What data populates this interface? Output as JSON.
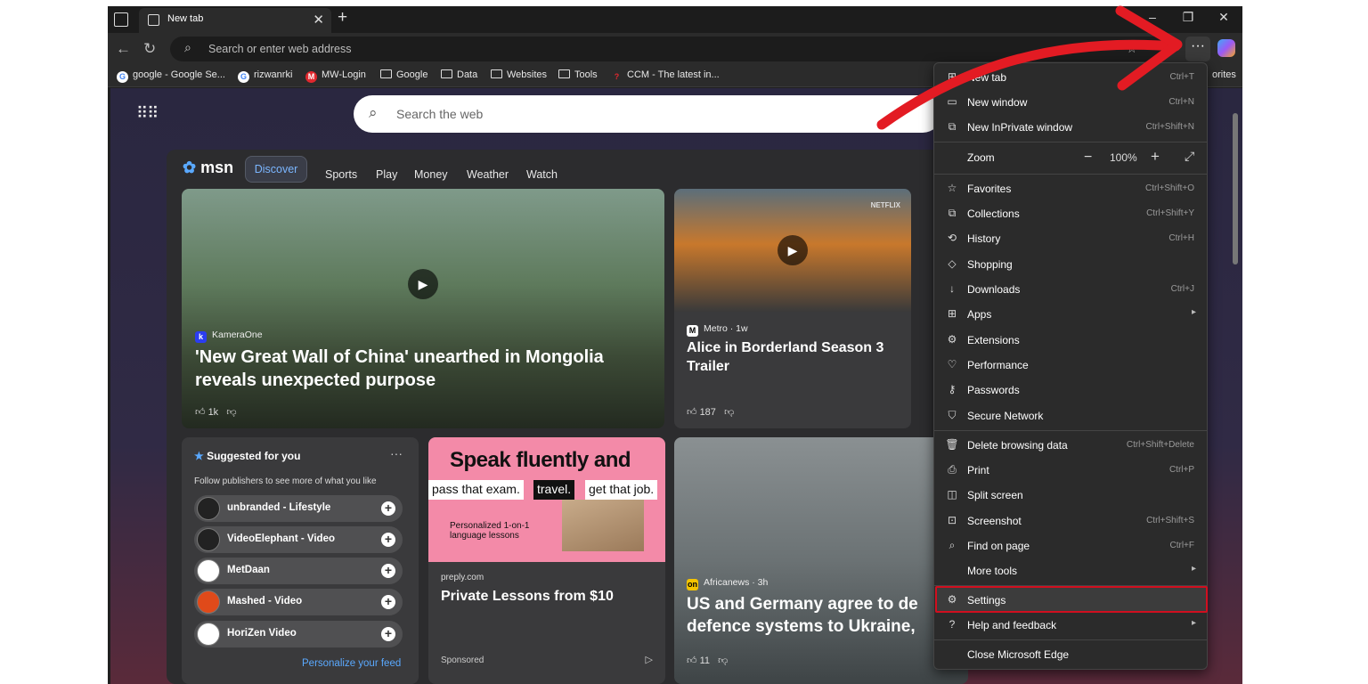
{
  "browser": {
    "tab_title": "New tab",
    "address_placeholder": "Search or enter web address",
    "bookmarks": [
      {
        "label": "google - Google Se...",
        "icon": "google-icon"
      },
      {
        "label": "rizwanrki",
        "icon": "google-icon"
      },
      {
        "label": "MW-Login",
        "icon": "mw-icon"
      },
      {
        "label": "Google",
        "icon": "folder-icon"
      },
      {
        "label": "Data",
        "icon": "folder-icon"
      },
      {
        "label": "Websites",
        "icon": "folder-icon"
      },
      {
        "label": "Tools",
        "icon": "folder-icon"
      },
      {
        "label": "CCM - The latest in...",
        "icon": "ccm-icon"
      }
    ],
    "bookmarks_overflow": "orites"
  },
  "newtab": {
    "search_placeholder": "Search the web",
    "msn_logo": "msn",
    "nav": [
      "Discover",
      "Sports",
      "Play",
      "Money",
      "Weather",
      "Watch"
    ],
    "hero": {
      "source": "KameraOne",
      "headline": "'New Great Wall of China' unearthed in Mongolia reveals unexpected purpose",
      "likes": "1k"
    },
    "card2": {
      "watermark": "NETFLIX",
      "source": "Metro · 1w",
      "headline": "Alice in Borderland Season 3 Trailer",
      "likes": "187"
    },
    "suggested": {
      "title": "Suggested for you",
      "subtitle": "Follow publishers to see more of what you like",
      "publishers": [
        "unbranded - Lifestyle",
        "VideoElephant - Video",
        "MetDaan",
        "Mashed - Video",
        "HoriZen Video"
      ],
      "personalize": "Personalize your feed"
    },
    "ad": {
      "headline_big": "Speak fluently and",
      "chips": [
        "pass that exam.",
        "travel.",
        "get that job."
      ],
      "small": "Personalized 1-on-1 language lessons",
      "domain": "preply.com",
      "title": "Private Lessons from $10",
      "sponsored": "Sponsored"
    },
    "card4": {
      "source": "Africanews · 3h",
      "headline": "US and Germany agree to de defence systems to Ukraine,",
      "likes": "11"
    }
  },
  "menu": {
    "items": [
      {
        "label": "New tab",
        "shortcut": "Ctrl+T",
        "icon": "new-tab-icon"
      },
      {
        "label": "New window",
        "shortcut": "Ctrl+N",
        "icon": "window-icon"
      },
      {
        "label": "New InPrivate window",
        "shortcut": "Ctrl+Shift+N",
        "icon": "inprivate-icon"
      },
      {
        "label": "Zoom",
        "zoom_value": "100%",
        "icon": "zoom-icon"
      },
      {
        "label": "Favorites",
        "shortcut": "Ctrl+Shift+O",
        "icon": "favorites-icon"
      },
      {
        "label": "Collections",
        "shortcut": "Ctrl+Shift+Y",
        "icon": "collections-icon"
      },
      {
        "label": "History",
        "shortcut": "Ctrl+H",
        "icon": "history-icon"
      },
      {
        "label": "Shopping",
        "shortcut": "",
        "icon": "shopping-icon"
      },
      {
        "label": "Downloads",
        "shortcut": "Ctrl+J",
        "icon": "download-icon"
      },
      {
        "label": "Apps",
        "shortcut": "",
        "icon": "apps-icon"
      },
      {
        "label": "Extensions",
        "shortcut": "",
        "icon": "extensions-icon"
      },
      {
        "label": "Performance",
        "shortcut": "",
        "icon": "performance-icon"
      },
      {
        "label": "Passwords",
        "shortcut": "",
        "icon": "key-icon"
      },
      {
        "label": "Secure Network",
        "shortcut": "",
        "icon": "shield-icon"
      },
      {
        "label": "Delete browsing data",
        "shortcut": "Ctrl+Shift+Delete",
        "icon": "trash-icon"
      },
      {
        "label": "Print",
        "shortcut": "Ctrl+P",
        "icon": "print-icon"
      },
      {
        "label": "Split screen",
        "shortcut": "",
        "icon": "split-icon"
      },
      {
        "label": "Screenshot",
        "shortcut": "Ctrl+Shift+S",
        "icon": "screenshot-icon"
      },
      {
        "label": "Find on page",
        "shortcut": "Ctrl+F",
        "icon": "find-icon"
      },
      {
        "label": "More tools",
        "shortcut": "",
        "icon": ""
      },
      {
        "label": "Settings",
        "shortcut": "",
        "icon": "gear-icon"
      },
      {
        "label": "Help and feedback",
        "shortcut": "",
        "icon": "help-icon"
      },
      {
        "label": "Close Microsoft Edge",
        "shortcut": "",
        "icon": ""
      }
    ]
  },
  "colors": {
    "highlight_border": "#d10f1f",
    "annotation_arrow": "#e31b23",
    "msn_accent": "#5aa9ff"
  }
}
